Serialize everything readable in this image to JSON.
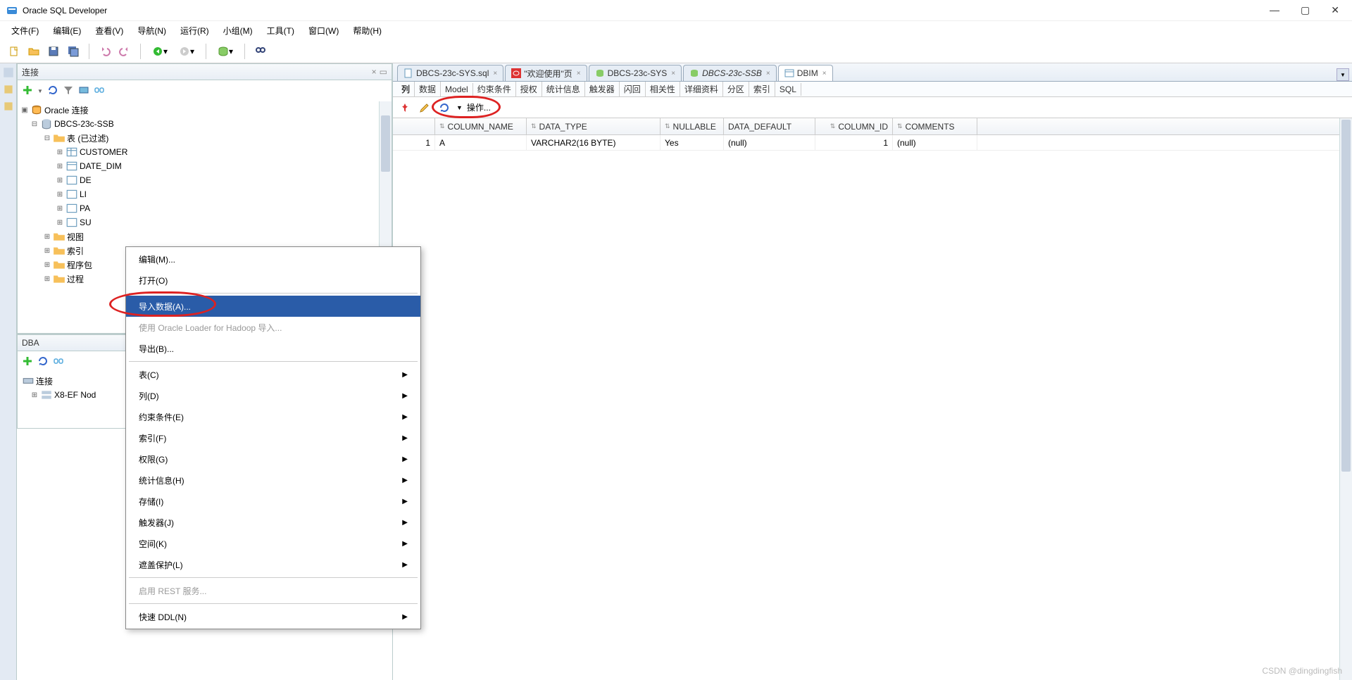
{
  "app": {
    "title": "Oracle SQL Developer"
  },
  "menu": {
    "file": "文件(F)",
    "edit": "编辑(E)",
    "view": "查看(V)",
    "nav": "导航(N)",
    "run": "运行(R)",
    "team": "小组(M)",
    "tools": "工具(T)",
    "window": "窗口(W)",
    "help": "帮助(H)"
  },
  "panels": {
    "connections_title": "连接",
    "dba_title": "DBA"
  },
  "tree": {
    "root": "Oracle 连接",
    "conn": "DBCS-23c-SSB",
    "tables_folder": "表 (已过滤)",
    "tables": [
      "CUSTOMER",
      "DATE_DIM",
      "DE",
      "LI",
      "PA",
      "SU"
    ],
    "folders": [
      "视图",
      "索引",
      "程序包",
      "过程"
    ]
  },
  "dba": {
    "conn": "连接",
    "node": "X8-EF Nod"
  },
  "tabs": {
    "t1": "DBCS-23c-SYS.sql",
    "t2": "\"欢迎使用\"页",
    "t3": "DBCS-23c-SYS",
    "t4": "DBCS-23c-SSB",
    "t5": "DBIM"
  },
  "subtabs": {
    "s1": "列",
    "s2": "数据",
    "s3": "Model",
    "s4": "约束条件",
    "s5": "授权",
    "s6": "统计信息",
    "s7": "触发器",
    "s8": "闪回",
    "s9": "相关性",
    "s10": "详细资料",
    "s11": "分区",
    "s12": "索引",
    "s13": "SQL"
  },
  "action_label": "操作...",
  "grid": {
    "h1": "COLUMN_NAME",
    "h2": "DATA_TYPE",
    "h3": "NULLABLE",
    "h4": "DATA_DEFAULT",
    "h5": "COLUMN_ID",
    "h6": "COMMENTS",
    "r1": {
      "n": "1",
      "col": "A",
      "type": "VARCHAR2(16 BYTE)",
      "null": "Yes",
      "def": "(null)",
      "id": "1",
      "com": "(null)"
    }
  },
  "ctx": {
    "edit": "编辑(M)...",
    "open": "打开(O)",
    "import": "导入数据(A)...",
    "hadoop": "使用 Oracle Loader for Hadoop 导入...",
    "export": "导出(B)...",
    "table": "表(C)",
    "column": "列(D)",
    "constraint": "约束条件(E)",
    "index": "索引(F)",
    "priv": "权限(G)",
    "stats": "统计信息(H)",
    "storage": "存储(I)",
    "trigger": "触发器(J)",
    "space": "空间(K)",
    "mask": "遮盖保护(L)",
    "rest": "启用 REST 服务...",
    "ddl": "快速 DDL(N)"
  },
  "watermark": "CSDN @dingdingfish"
}
